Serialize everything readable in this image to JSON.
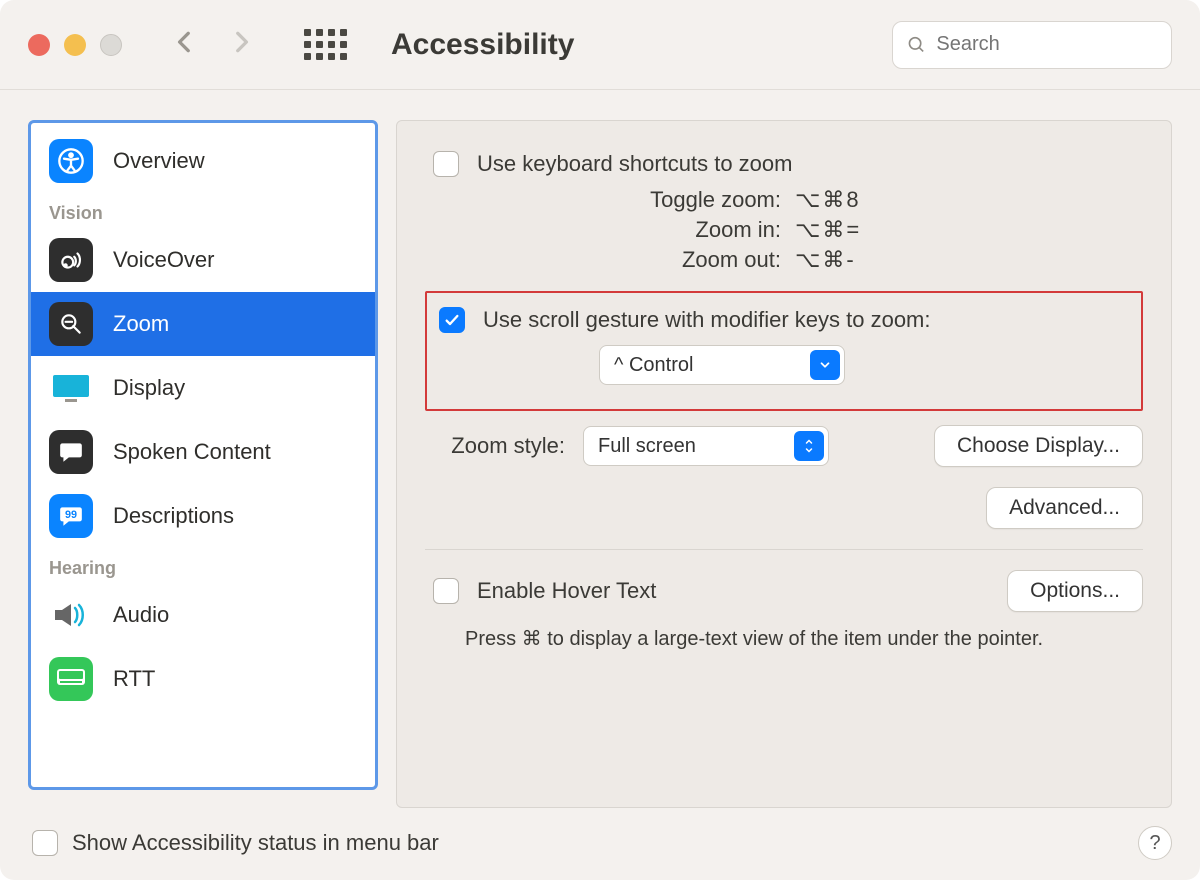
{
  "title": "Accessibility",
  "search_placeholder": "Search",
  "sidebar": {
    "sections": {
      "vision": "Vision",
      "hearing": "Hearing"
    },
    "items": {
      "overview": "Overview",
      "voiceover": "VoiceOver",
      "zoom": "Zoom",
      "display": "Display",
      "spoken": "Spoken Content",
      "descriptions": "Descriptions",
      "audio": "Audio",
      "rtt": "RTT"
    }
  },
  "zoom": {
    "kb_shortcuts_label": "Use keyboard shortcuts to zoom",
    "shortcuts": {
      "toggle_label": "Toggle zoom:",
      "toggle_keys": "⌥⌘8",
      "in_label": "Zoom in:",
      "in_keys": "⌥⌘=",
      "out_label": "Zoom out:",
      "out_keys": "⌥⌘-"
    },
    "scroll_gesture_label": "Use scroll gesture with modifier keys to zoom:",
    "modifier_value": "^ Control",
    "zoom_style_label": "Zoom style:",
    "zoom_style_value": "Full screen",
    "choose_display_btn": "Choose Display...",
    "advanced_btn": "Advanced...",
    "hover_text_label": "Enable Hover Text",
    "options_btn": "Options...",
    "hover_note": "Press ⌘ to display a large-text view of the item under the pointer."
  },
  "footer": {
    "menu_bar_status": "Show Accessibility status in menu bar"
  }
}
